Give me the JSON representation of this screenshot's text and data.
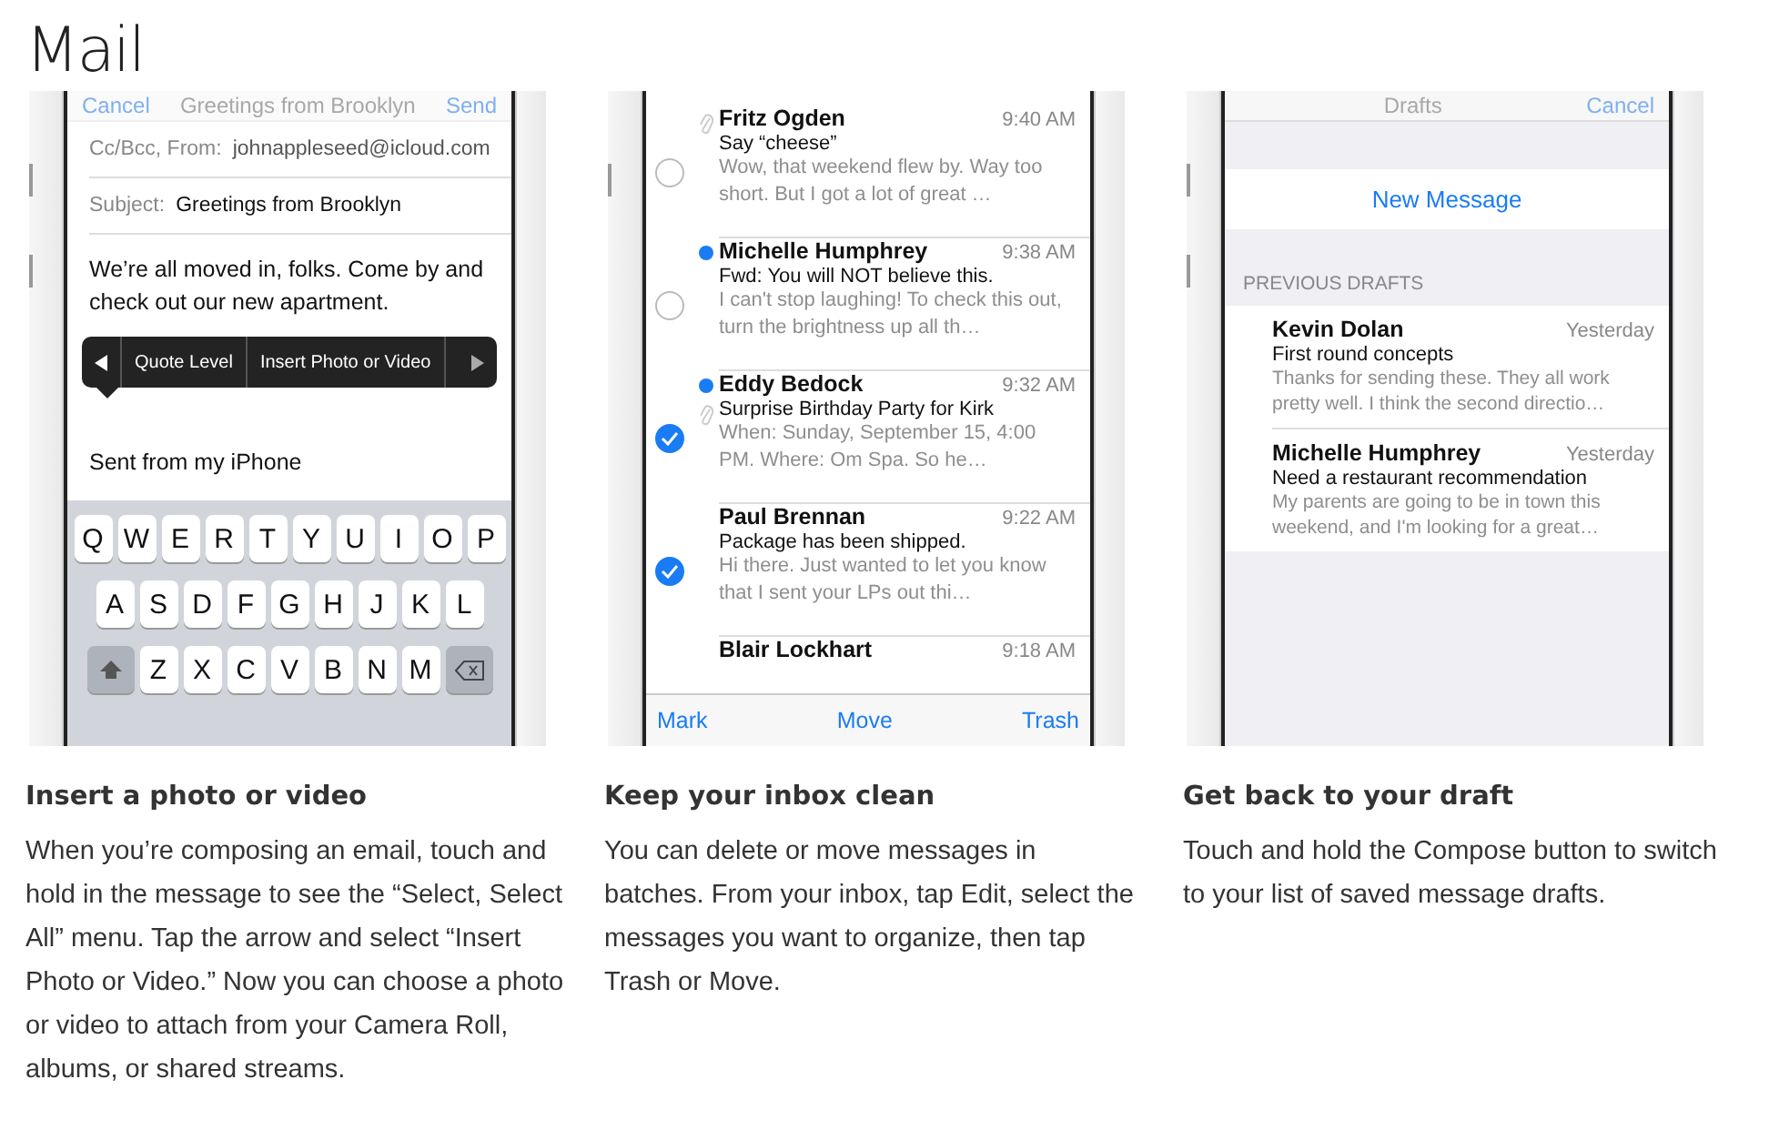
{
  "title": "Mail",
  "compose": {
    "nav_cancel": "Cancel",
    "nav_title": "Greetings from Brooklyn",
    "nav_send": "Send",
    "from_label": "Cc/Bcc, From:",
    "from_value": "johnappleseed@icloud.com",
    "subject_label": "Subject:",
    "subject_value": "Greetings from Brooklyn",
    "body": "We’re all moved in, folks. Come by and check out our new apartment.",
    "menu_items": [
      "Quote Level",
      "Insert Photo or Video"
    ],
    "signature": "Sent from my iPhone",
    "keyboard_rows": [
      [
        "Q",
        "W",
        "E",
        "R",
        "T",
        "Y",
        "U",
        "I",
        "O",
        "P"
      ],
      [
        "A",
        "S",
        "D",
        "F",
        "G",
        "H",
        "J",
        "K",
        "L"
      ],
      [
        "Z",
        "X",
        "C",
        "V",
        "B",
        "N",
        "M"
      ]
    ]
  },
  "inbox": {
    "messages": [
      {
        "sender": "Fritz Ogden",
        "time": "9:40 AM",
        "subject": "Say “cheese”",
        "preview": "Wow, that weekend flew by. Way too short. But I got a lot of great …",
        "unread": false,
        "attachment": true,
        "selected": false
      },
      {
        "sender": "Michelle Humphrey",
        "time": "9:38 AM",
        "subject": "Fwd: You will NOT believe this.",
        "preview": "I can't stop laughing! To check this out, turn the brightness up all th…",
        "unread": true,
        "attachment": false,
        "selected": false
      },
      {
        "sender": "Eddy Bedock",
        "time": "9:32 AM",
        "subject": "Surprise Birthday Party for Kirk",
        "preview": "When: Sunday, September 15, 4:00 PM. Where: Om Spa. So he…",
        "unread": true,
        "attachment": true,
        "selected": true
      },
      {
        "sender": "Paul Brennan",
        "time": "9:22 AM",
        "subject": "Package has been shipped.",
        "preview": "Hi there. Just wanted to let you know that I sent your LPs out thi…",
        "unread": false,
        "attachment": false,
        "selected": true
      },
      {
        "sender": "Blair Lockhart",
        "time": "9:18 AM"
      }
    ],
    "toolbar": [
      "Mark",
      "Move",
      "Trash"
    ]
  },
  "drafts": {
    "nav_title": "Drafts",
    "nav_cancel": "Cancel",
    "new_message": "New Message",
    "section": "PREVIOUS DRAFTS",
    "items": [
      {
        "sender": "Kevin Dolan",
        "time": "Yesterday",
        "subject": "First round concepts",
        "preview": "Thanks for sending these. They all work pretty well. I think the second directio…"
      },
      {
        "sender": "Michelle Humphrey",
        "time": "Yesterday",
        "subject": "Need a restaurant recommendation",
        "preview": "My parents are going to be in town this weekend, and I'm looking for a great…"
      }
    ]
  },
  "features": [
    {
      "heading": "Insert a photo or video",
      "text": "When you’re composing an email, touch and hold in the message to see the “Select, Select All” menu. Tap the arrow and select “Insert Photo or Video.” Now you can choose a photo or video to attach from your Camera Roll, albums, or shared streams."
    },
    {
      "heading": "Keep your inbox clean",
      "text": "You can delete or move messages in batches. From your inbox, tap Edit, select the messages you want to organize, then tap Trash or Move."
    },
    {
      "heading": "Get back to your draft",
      "text": "Touch and hold the Compose button to switch to your list of saved message drafts."
    }
  ]
}
